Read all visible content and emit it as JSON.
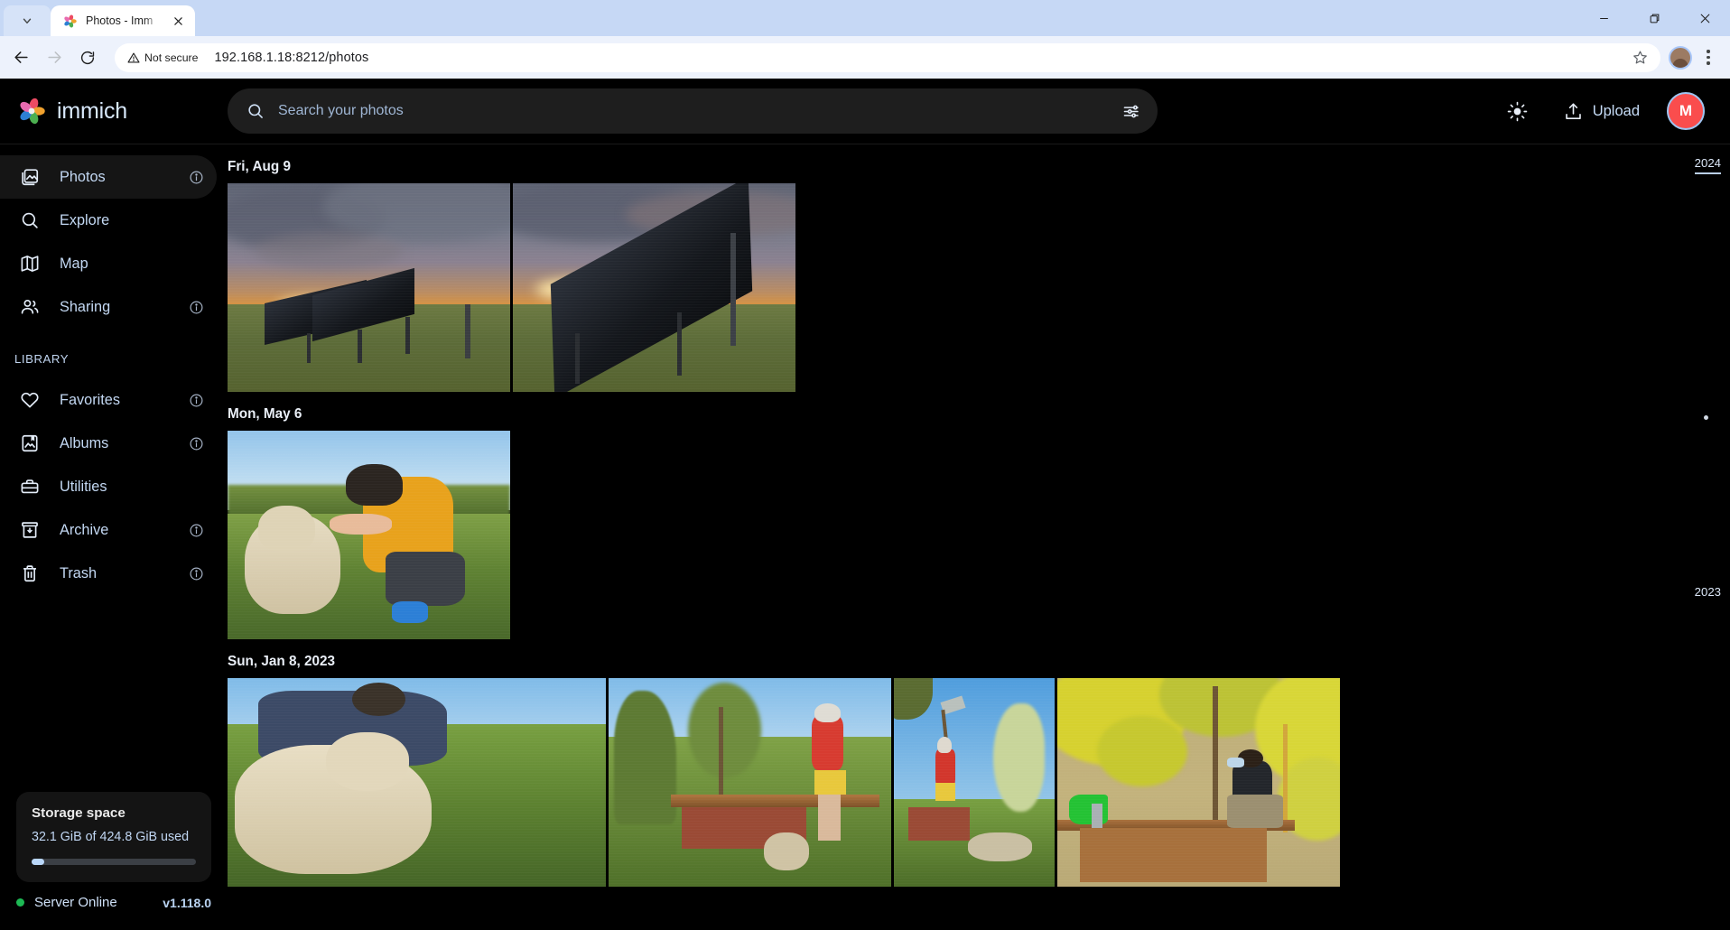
{
  "browser": {
    "tab": {
      "title": "Photos - Imm",
      "favicon_name": "immich-favicon"
    },
    "window_controls": {
      "minimize": "minimize",
      "maximize": "maximize",
      "close": "close"
    },
    "toolbar": {
      "back": "back",
      "forward": "forward",
      "reload": "reload",
      "security_label": "Not secure",
      "url": "192.168.1.18:8212/photos",
      "bookmark": "bookmark-star",
      "profile": "chrome-profile",
      "menu": "chrome-menu"
    }
  },
  "app": {
    "brand": "immich",
    "search": {
      "placeholder": "Search your photos",
      "value": ""
    },
    "header": {
      "theme_toggle": "sun-icon",
      "upload_label": "Upload",
      "avatar_initial": "M",
      "avatar_color": "#fa4d4d"
    },
    "sidebar": {
      "primary": [
        {
          "label": "Photos",
          "icon": "photos-icon",
          "info": true,
          "active": true
        },
        {
          "label": "Explore",
          "icon": "explore-icon",
          "info": false,
          "active": false
        },
        {
          "label": "Map",
          "icon": "map-icon",
          "info": false,
          "active": false
        },
        {
          "label": "Sharing",
          "icon": "sharing-icon",
          "info": true,
          "active": false
        }
      ],
      "library_title": "LIBRARY",
      "library": [
        {
          "label": "Favorites",
          "icon": "heart-icon",
          "info": true,
          "active": false
        },
        {
          "label": "Albums",
          "icon": "albums-icon",
          "info": true,
          "active": false
        },
        {
          "label": "Utilities",
          "icon": "utilities-icon",
          "info": false,
          "active": false
        },
        {
          "label": "Archive",
          "icon": "archive-icon",
          "info": true,
          "active": false
        },
        {
          "label": "Trash",
          "icon": "trash-icon",
          "info": true,
          "active": false
        }
      ],
      "storage": {
        "title": "Storage space",
        "detail": "32.1 GiB of 424.8 GiB used",
        "used_percent": 7.6
      },
      "status": {
        "label": "Server Online",
        "version": "v1.118.0",
        "dot_color": "#1db954"
      }
    },
    "timeline": {
      "groups": [
        {
          "date": "Fri, Aug 9",
          "photos": [
            {
              "alt": "solar-panels-sunset-wide"
            },
            {
              "alt": "solar-panels-sunset-close"
            }
          ]
        },
        {
          "date": "Mon, May 6",
          "photos": [
            {
              "alt": "man-petting-sheepdog-in-field"
            }
          ]
        },
        {
          "date": "Sun, Jan 8, 2023",
          "photos": [
            {
              "alt": "man-lying-with-sheepdog-on-grass"
            },
            {
              "alt": "boy-in-red-shirt-on-bench-with-dog"
            },
            {
              "alt": "boy-drinking-on-bench-sunny"
            },
            {
              "alt": "man-drinking-water-under-yellow-tree"
            }
          ]
        }
      ],
      "year_marks": [
        {
          "label": "2024",
          "underline": true
        },
        {
          "label": "2023",
          "underline": false
        }
      ]
    }
  }
}
